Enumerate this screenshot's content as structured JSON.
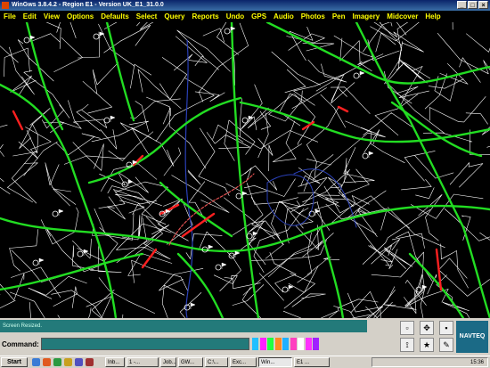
{
  "window": {
    "title": "WinGws 3.8.4.2 - Region E1 - Version UK_E1_31.0.0"
  },
  "menu": [
    "File",
    "Edit",
    "View",
    "Options",
    "Defaults",
    "Select",
    "Query",
    "Reports",
    "Undo",
    "GPS",
    "Audio",
    "Photos",
    "Pen",
    "Imagery",
    "Midcover",
    "Help"
  ],
  "map": {
    "background": "#000000",
    "colors": {
      "minor_road": "#ffffff",
      "major_road": "#22dd22",
      "highlight": "#ff2020",
      "water": "#2a40b8",
      "route": "#e05050"
    }
  },
  "status": {
    "message": "Screen Resized."
  },
  "command": {
    "label": "Command:",
    "value": ""
  },
  "swatches": [
    "#20c0ff",
    "#ff20ff",
    "#20ff40",
    "#ff8a20",
    "#20b0ff",
    "#ff40c0",
    "#ffffff",
    "#ff30ff",
    "#a020ff"
  ],
  "tool_icons": [
    "restore-icon",
    "pan-icon",
    "save-icon",
    "pointer-icon",
    "star-icon",
    "pen-icon"
  ],
  "brand": "NAVTEQ",
  "taskbar": {
    "start": "Start",
    "tasks": [
      "Inb...",
      "1 -...",
      "Job...",
      "GW...",
      "C:\\...",
      "Exc...",
      "Win...",
      "E1 ..."
    ],
    "active_task": 6,
    "clock": "15:36"
  }
}
